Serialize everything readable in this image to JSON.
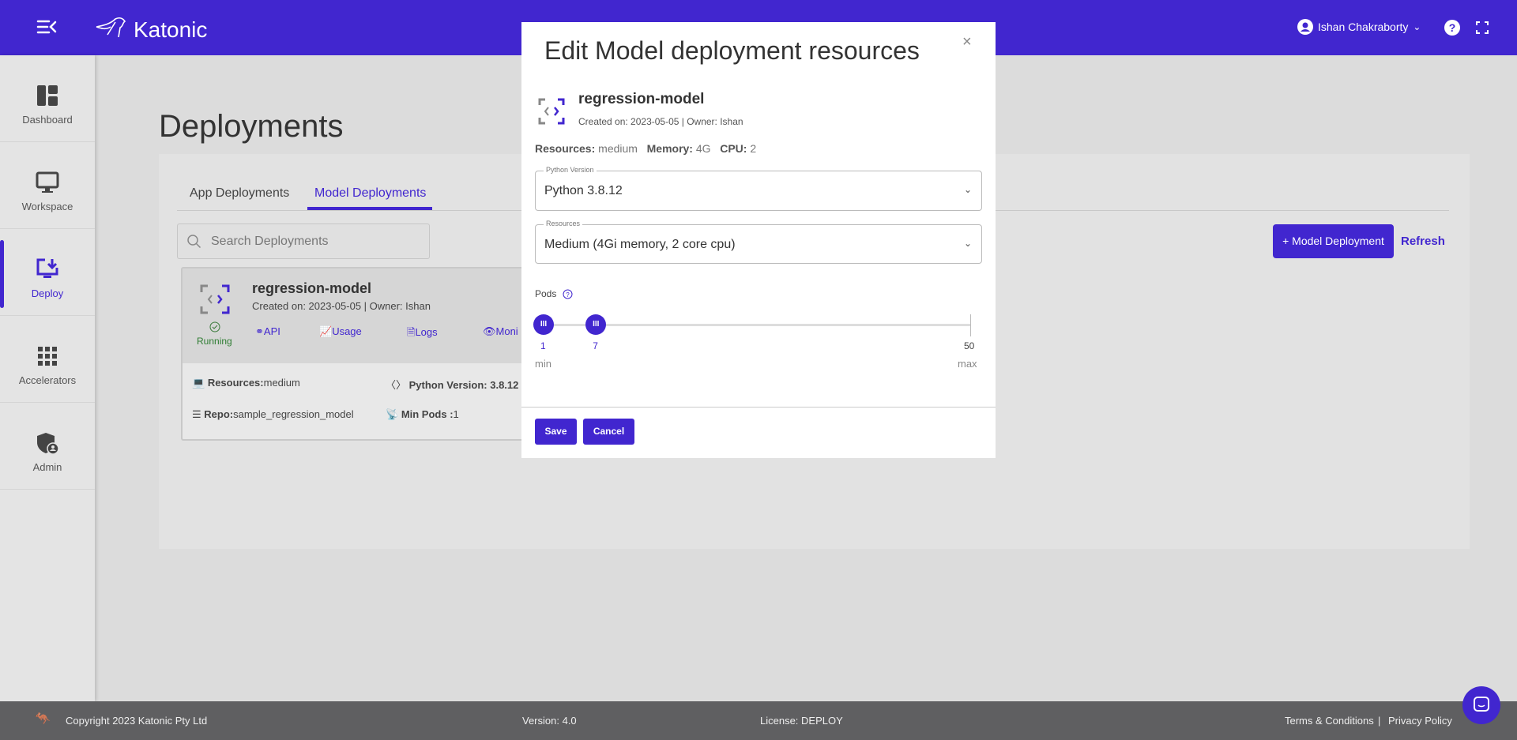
{
  "header": {
    "brand": "Katonic",
    "user": "Ishan Chakraborty",
    "colors": {
      "primary": "#4126cf"
    }
  },
  "sidebar": {
    "items": [
      {
        "label": "Dashboard",
        "icon": "dashboard-icon"
      },
      {
        "label": "Workspace",
        "icon": "monitor-icon"
      },
      {
        "label": "Deploy",
        "icon": "deploy-icon",
        "active": true
      },
      {
        "label": "Accelerators",
        "icon": "grid-icon"
      },
      {
        "label": "Admin",
        "icon": "shield-user-icon"
      }
    ]
  },
  "main": {
    "title": "Deployments",
    "tabs": [
      {
        "label": "App Deployments"
      },
      {
        "label": "Model Deployments",
        "active": true
      }
    ],
    "search_placeholder": "Search Deployments",
    "add_button": "+ Model Deployment",
    "refresh": "Refresh",
    "card": {
      "name": "regression-model",
      "meta": "Created on: 2023-05-05 | Owner: Ishan",
      "status": "Running",
      "links": [
        "API",
        "Usage",
        "Logs",
        "Moni"
      ],
      "resources_label": "Resources:",
      "resources": "medium",
      "python_label": "Python Version:",
      "python": "3.8.12",
      "repo_label": "Repo:",
      "repo": "sample_regression_model",
      "pods_label": "Min Pods :",
      "pods": "1"
    }
  },
  "modal": {
    "title": "Edit Model deployment resources",
    "close": "×",
    "name": "regression-model",
    "meta": "Created on: 2023-05-05 | Owner: Ishan",
    "resources_label": "Resources:",
    "resources": "medium",
    "memory_label": "Memory:",
    "memory": "4G",
    "cpu_label": "CPU:",
    "cpu": "2",
    "python_select": {
      "label": "Python Version",
      "value": "Python 3.8.12"
    },
    "resources_select": {
      "label": "Resources",
      "value": "Medium (4Gi memory, 2 core cpu)"
    },
    "pods": {
      "label": "Pods",
      "min": 1,
      "max": 50,
      "low": 1,
      "high": 7,
      "min_label": "min",
      "max_label": "max",
      "low_text": "1",
      "high_text": "7",
      "max_text": "50"
    },
    "save": "Save",
    "cancel": "Cancel"
  },
  "footer": {
    "copyright": "Copyright 2023 Katonic Pty Ltd",
    "version": "Version: 4.0",
    "license": "License: DEPLOY",
    "terms": "Terms & Conditions",
    "sep": "|",
    "privacy": "Privacy Policy"
  }
}
